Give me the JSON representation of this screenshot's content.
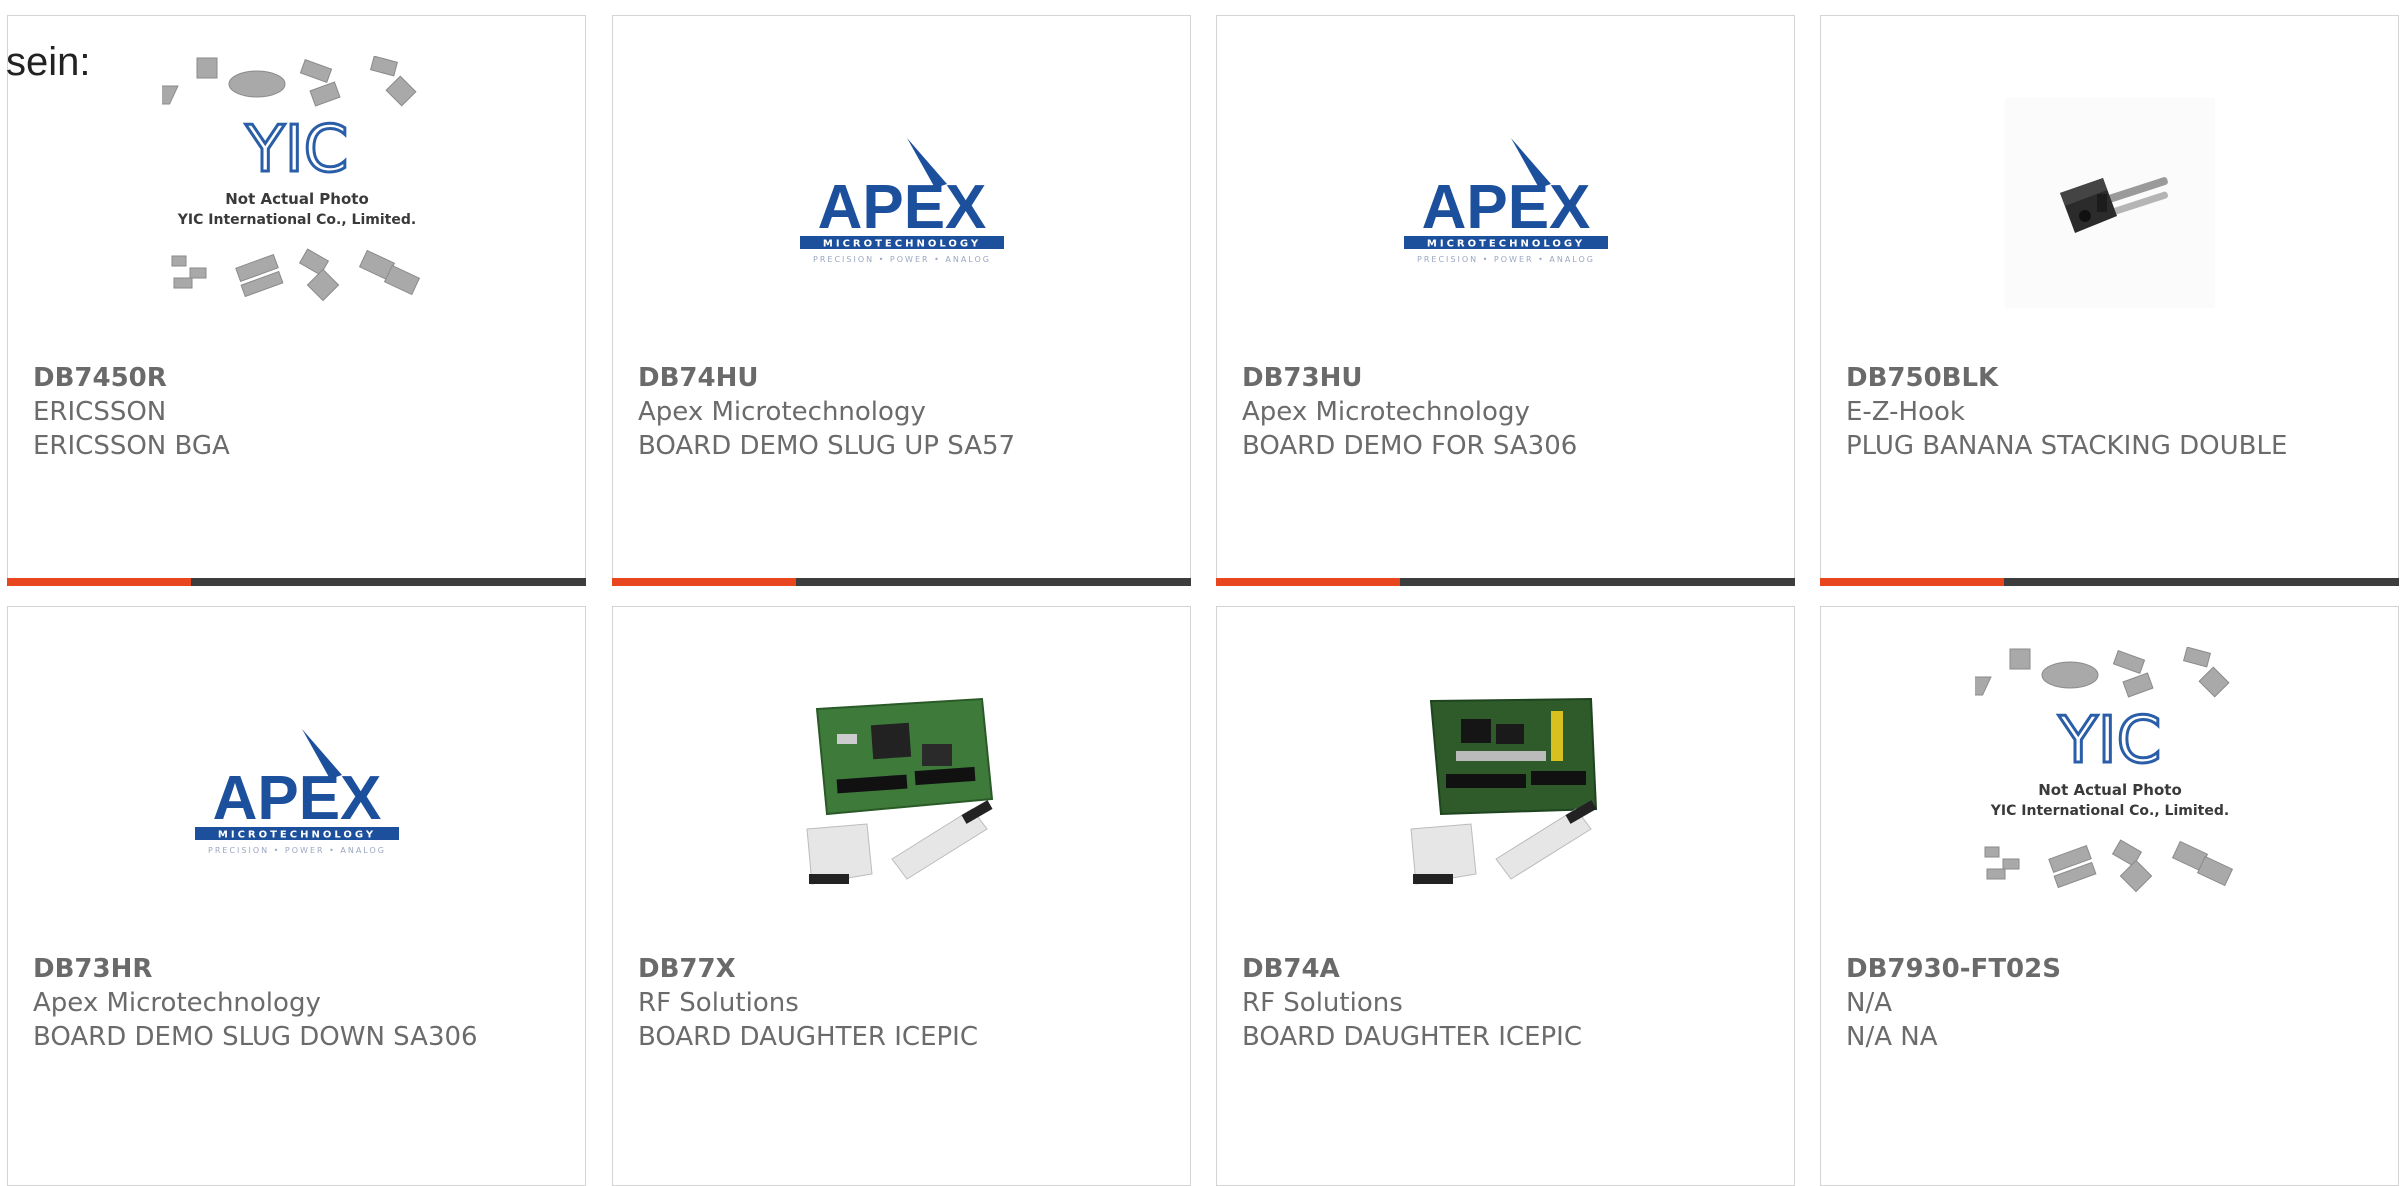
{
  "intro_text": "sein:",
  "products": [
    {
      "part": "DB7450R",
      "maker": "ERICSSON",
      "desc": "ERICSSON BGA",
      "image": "placeholder-photo"
    },
    {
      "part": "DB74HU",
      "maker": "Apex Microtechnology",
      "desc": "BOARD DEMO SLUG UP SA57",
      "image": "apex-logo"
    },
    {
      "part": "DB73HU",
      "maker": "Apex Microtechnology",
      "desc": "BOARD DEMO FOR SA306",
      "image": "apex-logo"
    },
    {
      "part": "DB750BLK",
      "maker": "E-Z-Hook",
      "desc": "PLUG BANANA STACKING DOUBLE",
      "image": "banana-plug-photo"
    },
    {
      "part": "DB73HR",
      "maker": "Apex Microtechnology",
      "desc": "BOARD DEMO SLUG DOWN SA306",
      "image": "apex-logo"
    },
    {
      "part": "DB77X",
      "maker": "RF Solutions",
      "desc": "BOARD DAUGHTER ICEPIC",
      "image": "daughter-board-photo"
    },
    {
      "part": "DB74A",
      "maker": "RF Solutions",
      "desc": "BOARD DAUGHTER ICEPIC",
      "image": "daughter-board-photo"
    },
    {
      "part": "DB7930-FT02S",
      "maker": "N/A",
      "desc": "N/A NA",
      "image": "placeholder-photo"
    }
  ],
  "placeholder": {
    "line1": "Not Actual Photo",
    "line2": "YIC International Co., Limited.",
    "logo": "YIC"
  },
  "apex_logo": {
    "wordmark": "APEX",
    "subline": "MICROTECHNOLOGY",
    "tagline": "PRECISION • POWER • ANALOG"
  },
  "colors": {
    "accent": "#e8461f",
    "bar": "#3d3d3d",
    "apex_blue": "#1c4f9c",
    "text": "#6b6b6b",
    "border": "#d4d4d4"
  }
}
